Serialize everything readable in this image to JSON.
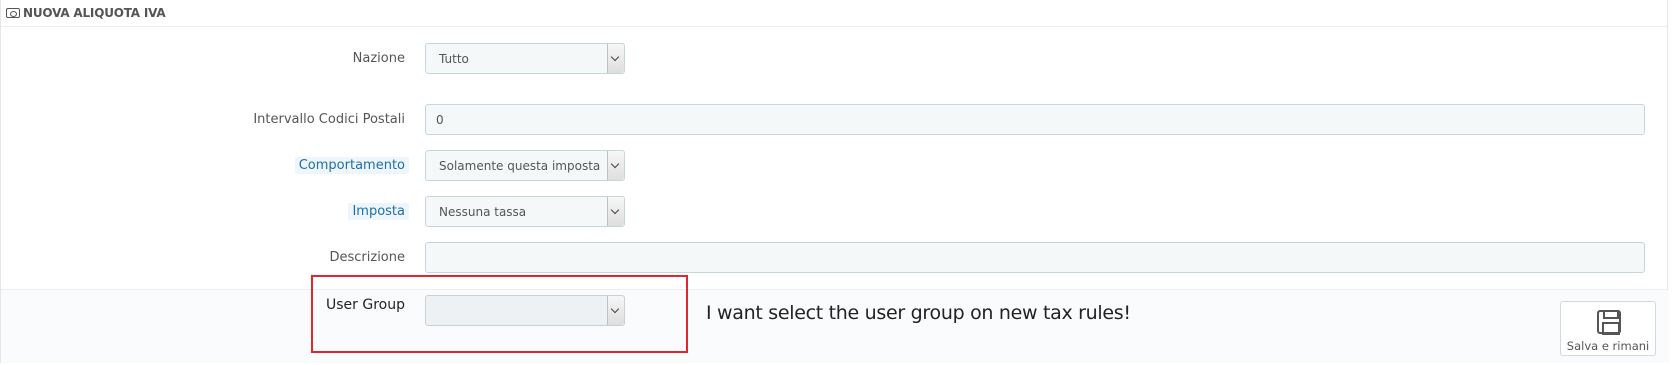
{
  "panel": {
    "title": "NUOVA ALIQUOTA IVA",
    "icon": "money-icon"
  },
  "form": {
    "country": {
      "label": "Nazione",
      "value": "Tutto"
    },
    "zip_range": {
      "label": "Intervallo Codici Postali",
      "value": "0"
    },
    "behavior": {
      "label": "Comportamento",
      "value": "Solamente questa imposta"
    },
    "tax": {
      "label": "Imposta",
      "value": "Nessuna tassa"
    },
    "description": {
      "label": "Descrizione",
      "value": ""
    },
    "user_group": {
      "label": "User Group",
      "value": ""
    }
  },
  "footer": {
    "save_stay_label": "Salva e rimani",
    "save_icon": "save-icon"
  },
  "annotation": {
    "text": "I want select the user group on new tax rules!",
    "color": "#e3262e"
  }
}
